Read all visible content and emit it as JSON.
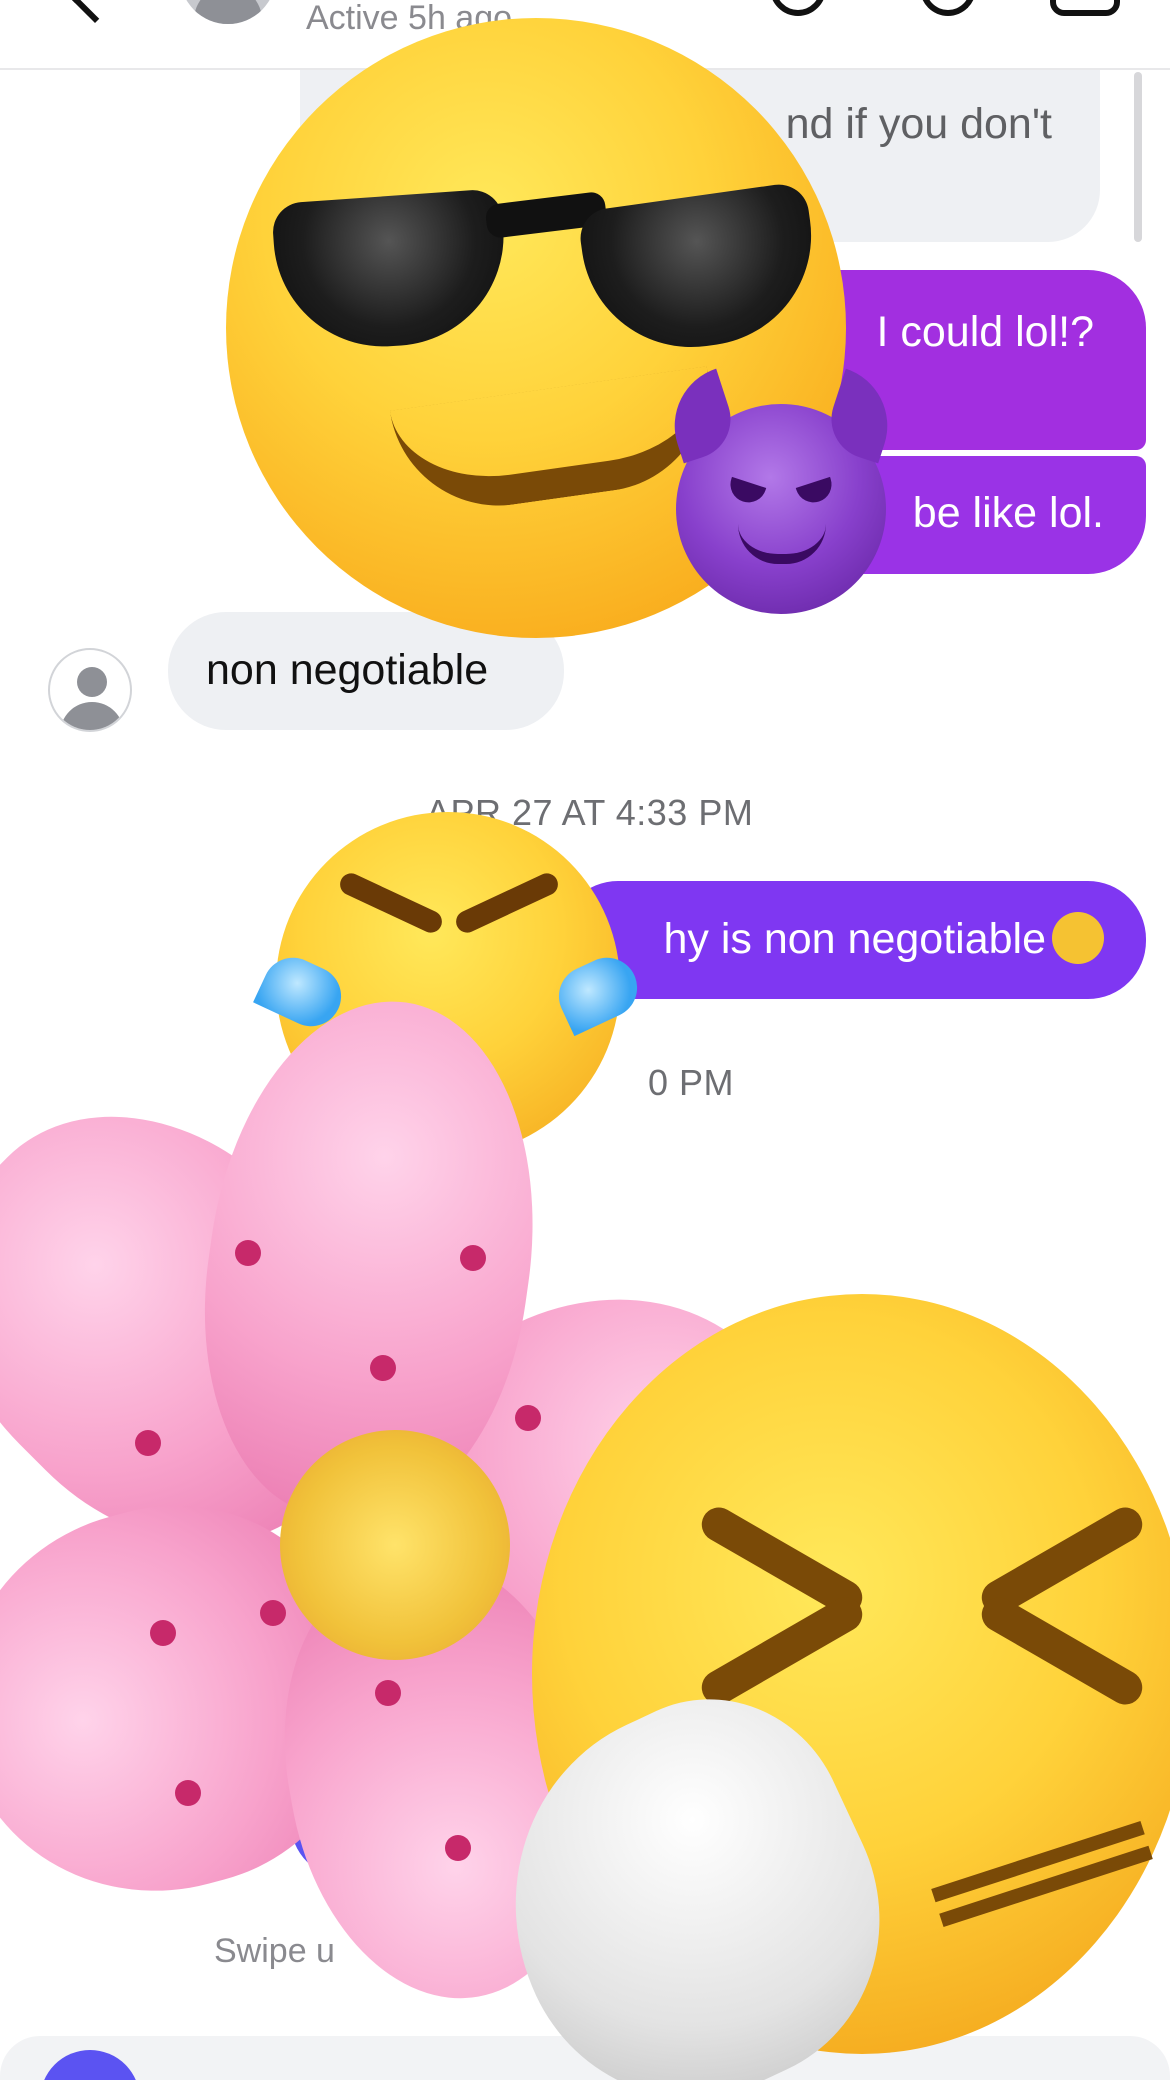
{
  "header": {
    "status": "Active 5h ago",
    "back_icon": "chevron-left-icon",
    "icons": [
      "audio-call-icon",
      "phone-icon",
      "video-call-icon"
    ]
  },
  "messages": [
    {
      "id": "m1",
      "direction": "incoming",
      "text": "nd if you don't"
    },
    {
      "id": "m2",
      "direction": "outgoing",
      "text": "I could lol!?"
    },
    {
      "id": "m3",
      "direction": "outgoing",
      "text": "be like lol."
    },
    {
      "id": "m4",
      "direction": "incoming",
      "text": "non negotiable"
    },
    {
      "id": "m5",
      "direction": "outgoing",
      "text": "hy is non negotiable",
      "trailing_emoji": "thinking-face-emoji"
    }
  ],
  "timestamps": [
    "APR 27 AT 4:33 PM",
    "0 PM"
  ],
  "footer": {
    "swipe_hint": "Swipe u"
  },
  "colors": {
    "outgoing_bubble_1": "#a22fe0",
    "outgoing_bubble_2": "#9a33e6",
    "outgoing_bubble_3": "#7f37f2",
    "incoming_bubble": "#eef0f3",
    "accent_button": "#5b53f2"
  },
  "overlay_emojis": [
    "smiling-face-with-sunglasses-emoji",
    "smiling-face-with-horns-emoji",
    "face-with-tears-of-joy-emoji",
    "cherry-blossom-emoji",
    "sneezing-face-emoji"
  ]
}
